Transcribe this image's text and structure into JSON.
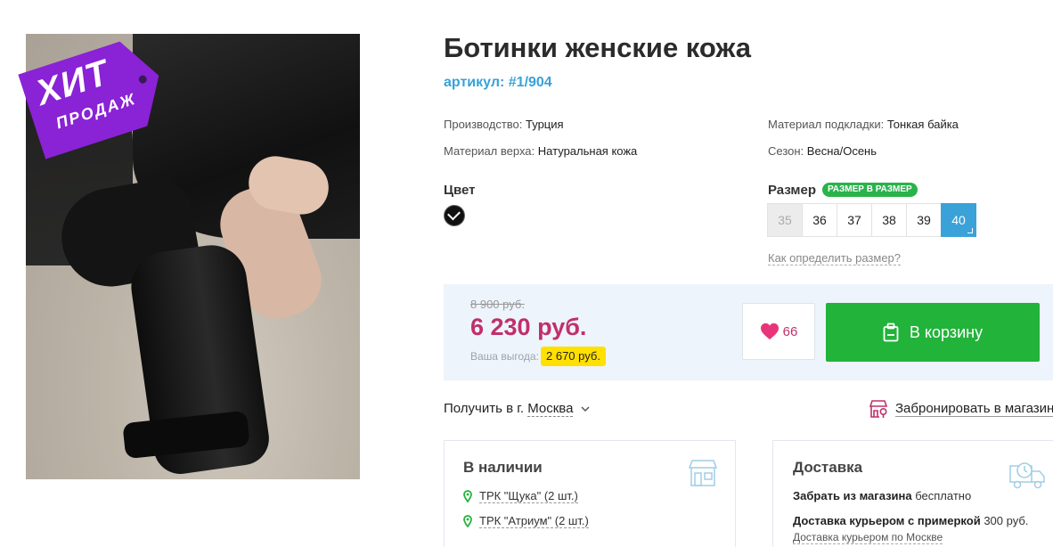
{
  "product": {
    "title": "Ботинки женские кожа",
    "article": "артикул: #1/904",
    "badge": {
      "line1": "ХИТ",
      "line2": "ПРОДАЖ"
    }
  },
  "attributes": [
    {
      "label": "Производство:",
      "value": "Турция"
    },
    {
      "label": "Материал верха:",
      "value": "Натуральная кожа"
    },
    {
      "label": "Материал подкладки:",
      "value": "Тонкая байка"
    },
    {
      "label": "Сезон:",
      "value": "Весна/Осень"
    }
  ],
  "color": {
    "label": "Цвет",
    "selected_hex": "#111111"
  },
  "size": {
    "label": "Размер",
    "badge": "РАЗМЕР В РАЗМЕР",
    "options": [
      "35",
      "36",
      "37",
      "38",
      "39",
      "40"
    ],
    "disabled": [
      "35"
    ],
    "selected": "40",
    "help_link": "Как определить размер?"
  },
  "price": {
    "old": "8 900 руб.",
    "current": "6 230 руб.",
    "savings_label": "Ваша выгода:",
    "savings_value": "2 670 руб."
  },
  "actions": {
    "favorites_count": "66",
    "cart_label": "В корзину"
  },
  "delivery_line": {
    "prefix": "Получить в г.",
    "city": "Москва",
    "reserve_label": "Забронировать в магазине"
  },
  "availability": {
    "title": "В наличии",
    "stores": [
      "ТРК \"Щука\" (2 шт.)",
      "ТРК \"Атриум\" (2 шт.)"
    ]
  },
  "shipping": {
    "title": "Доставка",
    "lines": [
      {
        "bold": "Забрать из магазина",
        "rest": " бесплатно"
      },
      {
        "bold": "Доставка курьером с примеркой",
        "rest": " 300 руб."
      },
      {
        "bold": "",
        "rest": "Доставка курьером по Москве"
      }
    ]
  },
  "colors": {
    "accent_blue": "#3aa2d8",
    "price_red": "#c0306a",
    "cart_green": "#22b33a",
    "badge_purple": "#8a22d6",
    "savings_yellow": "#ffe000"
  }
}
